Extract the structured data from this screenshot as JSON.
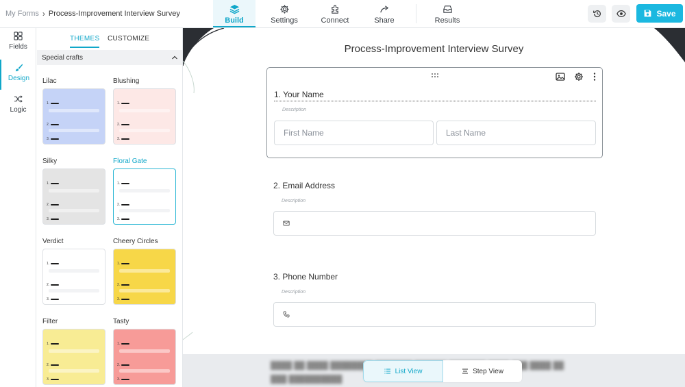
{
  "breadcrumb": {
    "parent": "My Forms",
    "separator": "›",
    "current": "Process-Improvement Interview Survey"
  },
  "nav": {
    "tabs": [
      {
        "label": "Build",
        "icon": "layers-icon",
        "active": true
      },
      {
        "label": "Settings",
        "icon": "gear-icon",
        "active": false
      },
      {
        "label": "Connect",
        "icon": "puzzle-icon",
        "active": false
      },
      {
        "label": "Share",
        "icon": "share-arrow-icon",
        "active": false
      },
      {
        "label": "Results",
        "icon": "inbox-icon",
        "active": false
      }
    ],
    "save_label": "Save"
  },
  "rail": {
    "items": [
      {
        "label": "Fields",
        "icon": "grid-icon",
        "active": false
      },
      {
        "label": "Design",
        "icon": "brush-icon",
        "active": true
      },
      {
        "label": "Logic",
        "icon": "shuffle-icon",
        "active": false
      }
    ]
  },
  "panel": {
    "tabs": [
      {
        "label": "THEMES",
        "active": true
      },
      {
        "label": "CUSTOMIZE",
        "active": false
      }
    ],
    "section_title": "Special crafts",
    "themes": [
      {
        "name": "Lilac",
        "bg": "#c5d3f7",
        "selected": false
      },
      {
        "name": "Blushing",
        "bg": "#fde8e6",
        "selected": false
      },
      {
        "name": "Silky",
        "bg": "#e4e4e4",
        "selected": false
      },
      {
        "name": "Floral Gate",
        "bg": "#ffffff",
        "selected": true
      },
      {
        "name": "Verdict",
        "bg": "#ffffff",
        "selected": false
      },
      {
        "name": "Cheery Circles",
        "bg": "#f7d748",
        "selected": false
      },
      {
        "name": "Filter",
        "bg": "#f8ec94",
        "selected": false
      },
      {
        "name": "Tasty",
        "bg": "#f79b98",
        "selected": false
      }
    ]
  },
  "form": {
    "title": "Process-Improvement Interview Survey",
    "questions": [
      {
        "label": "1. Your Name",
        "description": "Description",
        "first_placeholder": "First Name",
        "last_placeholder": "Last Name"
      },
      {
        "label": "2. Email Address",
        "description": "Description",
        "input_icon": "envelope-icon"
      },
      {
        "label": "3. Phone Number",
        "description": "Description",
        "input_icon": "phone-icon"
      }
    ]
  },
  "view_toggle": {
    "list_label": "List View",
    "step_label": "Step View"
  },
  "colors": {
    "accent": "#10a7c9",
    "save_button": "#1bb8e0",
    "canvas_decor": "#2b2e33"
  }
}
